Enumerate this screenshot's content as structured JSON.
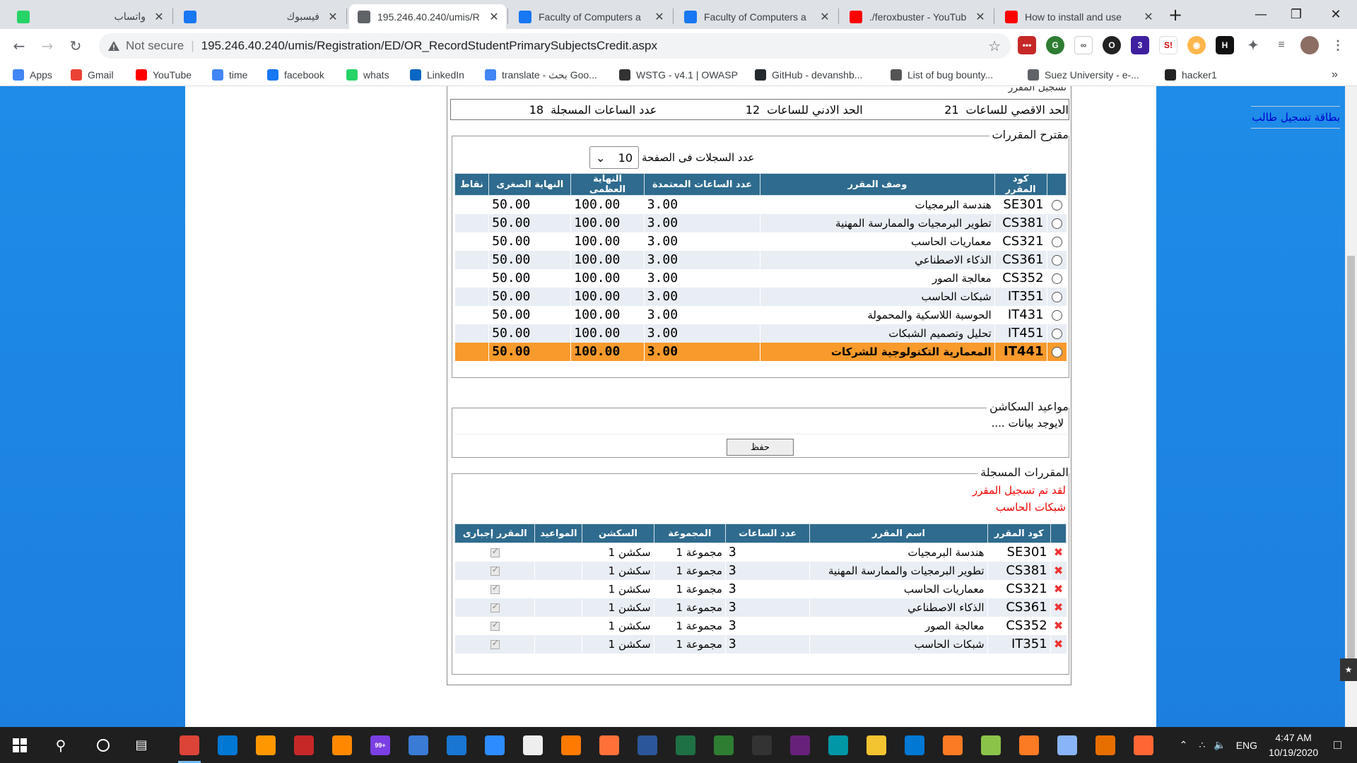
{
  "browser": {
    "tabs": [
      {
        "title": "واتساب",
        "rtl": true,
        "icon": "whatsapp-icon",
        "color": "#25d366"
      },
      {
        "title": "فيسبوك",
        "rtl": true,
        "icon": "facebook-icon",
        "color": "#1877f2"
      },
      {
        "title": "195.246.40.240/umis/R",
        "rtl": false,
        "icon": "globe-icon",
        "color": "#5f6368",
        "active": true
      },
      {
        "title": "Faculty of Computers a",
        "rtl": false,
        "icon": "facebook-icon",
        "color": "#1877f2"
      },
      {
        "title": "Faculty of Computers a",
        "rtl": false,
        "icon": "facebook-icon",
        "color": "#1877f2"
      },
      {
        "title": "./feroxbuster - YouTub",
        "rtl": false,
        "icon": "youtube-icon",
        "color": "#ff0000"
      },
      {
        "title": "How to install and use",
        "rtl": false,
        "icon": "youtube-icon",
        "color": "#ff0000"
      }
    ],
    "new_tab": "+",
    "address": {
      "security": "Not secure",
      "url": "195.246.40.240/umis/Registration/ED/OR_RecordStudentPrimarySubjectsCredit.aspx"
    },
    "bookmarks": [
      {
        "label": "Apps",
        "icon": "apps-icon",
        "color": "#4285f4"
      },
      {
        "label": "Gmail",
        "icon": "gmail-icon",
        "color": "#ea4335"
      },
      {
        "label": "YouTube",
        "icon": "youtube-icon",
        "color": "#ff0000"
      },
      {
        "label": "time",
        "icon": "google-icon",
        "color": "#4285f4"
      },
      {
        "label": "facebook",
        "icon": "facebook-icon",
        "color": "#1877f2"
      },
      {
        "label": "whats",
        "icon": "whatsapp-icon",
        "color": "#25d366"
      },
      {
        "label": "LinkedIn",
        "icon": "linkedin-icon",
        "color": "#0a66c2"
      },
      {
        "label": "translate - بحث Goo...",
        "icon": "google-icon",
        "color": "#4285f4"
      },
      {
        "label": "WSTG - v4.1 | OWASP",
        "icon": "owasp-icon",
        "color": "#333333"
      },
      {
        "label": "GitHub - devanshb...",
        "icon": "github-icon",
        "color": "#24292e"
      },
      {
        "label": "List of bug bounty...",
        "icon": "bug-icon",
        "color": "#555555"
      },
      {
        "label": "Suez University - e-...",
        "icon": "globe-icon",
        "color": "#5f6368"
      },
      {
        "label": "hacker1",
        "icon": "hackerone-icon",
        "color": "#222222"
      }
    ],
    "bookmarks_more": "»"
  },
  "page": {
    "side_link": "بطاقة تسجيل طالب",
    "top_cut": "تسجيل المقرر",
    "summary": [
      {
        "label": "الحد الاقصي للساعات",
        "value": "21"
      },
      {
        "label": "الحد الادني للساعات",
        "value": "12"
      },
      {
        "label": "عدد الساعات المسجلة",
        "value": "18"
      }
    ],
    "proposed": {
      "legend": "مقترح المقررات",
      "page_size_label": "عدد السجلات فى الصفحة",
      "page_size": "10",
      "headers": [
        "كود المقرر",
        "وصف المقرر",
        "عدد الساعات المعتمدة",
        "النهاية العظمى",
        "النهاية الصغرى",
        "نقاط"
      ],
      "rows": [
        {
          "code": "SE301",
          "desc": "هندسة البرمجيات",
          "hours": "3.00",
          "max": "100.00",
          "min": "50.00"
        },
        {
          "code": "CS381",
          "desc": "تطوير البرمجيات والممارسة المهنية",
          "hours": "3.00",
          "max": "100.00",
          "min": "50.00"
        },
        {
          "code": "CS321",
          "desc": "معماريات الحاسب",
          "hours": "3.00",
          "max": "100.00",
          "min": "50.00"
        },
        {
          "code": "CS361",
          "desc": "الذكاء الاصطناعي",
          "hours": "3.00",
          "max": "100.00",
          "min": "50.00"
        },
        {
          "code": "CS352",
          "desc": "معالجة الصور",
          "hours": "3.00",
          "max": "100.00",
          "min": "50.00"
        },
        {
          "code": "IT351",
          "desc": "شبكات الحاسب",
          "hours": "3.00",
          "max": "100.00",
          "min": "50.00"
        },
        {
          "code": "IT431",
          "desc": "الحوسبة اللاسكية والمحمولة",
          "hours": "3.00",
          "max": "100.00",
          "min": "50.00"
        },
        {
          "code": "IT451",
          "desc": "تحليل وتصميم الشبكات",
          "hours": "3.00",
          "max": "100.00",
          "min": "50.00"
        },
        {
          "code": "IT441",
          "desc": "المعمارية التكنولوجية للشركات",
          "hours": "3.00",
          "max": "100.00",
          "min": "50.00",
          "selected": true
        }
      ],
      "highlight_color": "#f89a2c"
    },
    "sections": {
      "legend": "مواعيد السكاشن",
      "empty_text": "لايوجد بيانات ....",
      "save_label": "حفظ"
    },
    "registered": {
      "legend": "المقررات المسجلة",
      "message": "لقد تم تسجيل المقرر",
      "message_course": "شبكات الحاسب",
      "headers": [
        "كود المقرر",
        "اسم المقرر",
        "عدد الساعات",
        "المجموعة",
        "السكشن",
        "المواعيد",
        "المقرر إجبارى"
      ],
      "rows": [
        {
          "code": "SE301",
          "name": "هندسة البرمجيات",
          "hours": "3",
          "group": "مجموعة 1",
          "section": "سكشن 1"
        },
        {
          "code": "CS381",
          "name": "تطوير البرمجيات والممارسة المهنية",
          "hours": "3",
          "group": "مجموعة 1",
          "section": "سكشن 1"
        },
        {
          "code": "CS321",
          "name": "معماريات الحاسب",
          "hours": "3",
          "group": "مجموعة 1",
          "section": "سكشن 1"
        },
        {
          "code": "CS361",
          "name": "الذكاء الاصطناعي",
          "hours": "3",
          "group": "مجموعة 1",
          "section": "سكشن 1"
        },
        {
          "code": "CS352",
          "name": "معالجة الصور",
          "hours": "3",
          "group": "مجموعة 1",
          "section": "سكشن 1"
        },
        {
          "code": "IT351",
          "name": "شبكات الحاسب",
          "hours": "3",
          "group": "مجموعة 1",
          "section": "سكشن 1"
        }
      ]
    }
  },
  "taskbar": {
    "apps": [
      {
        "icon": "chrome-icon",
        "color": "#db4437",
        "open": true
      },
      {
        "icon": "vscode-icon",
        "color": "#0078d4"
      },
      {
        "icon": "sublime-icon",
        "color": "#ff9800"
      },
      {
        "icon": "cherry-icon",
        "color": "#c62828"
      },
      {
        "icon": "vlc-icon",
        "color": "#ff8800"
      },
      {
        "icon": "badge-app-icon",
        "color": "#7b3fe4",
        "badge": "99+"
      },
      {
        "icon": "folder-app-icon",
        "color": "#3a7bd5"
      },
      {
        "icon": "cube-icon",
        "color": "#1976d2"
      },
      {
        "icon": "zoom-icon",
        "color": "#2d8cff"
      },
      {
        "icon": "document-icon",
        "color": "#eeeeee"
      },
      {
        "icon": "g-app-icon",
        "color": "#ff7a00"
      },
      {
        "icon": "firefox-icon",
        "color": "#ff7139"
      },
      {
        "icon": "word-icon",
        "color": "#2b579a"
      },
      {
        "icon": "sheets-icon",
        "color": "#1e7145"
      },
      {
        "icon": "globe-app-icon",
        "color": "#2e7d32"
      },
      {
        "icon": "terminal-icon",
        "color": "#333333"
      },
      {
        "icon": "visual-studio-icon",
        "color": "#68217a"
      },
      {
        "icon": "network-icon",
        "color": "#0097a7"
      },
      {
        "icon": "file-explorer-icon",
        "color": "#f4c430"
      },
      {
        "icon": "mail-icon",
        "color": "#0078d4"
      },
      {
        "icon": "xampp-icon",
        "color": "#fb7a24"
      },
      {
        "icon": "tools-icon",
        "color": "#8bc34a"
      },
      {
        "icon": "xampp-icon",
        "color": "#fb7a24"
      },
      {
        "icon": "drive-icon",
        "color": "#8ab4f8"
      },
      {
        "icon": "java-icon",
        "color": "#e76f00"
      },
      {
        "icon": "burp-icon",
        "color": "#ff6633"
      }
    ],
    "language": "ENG",
    "time": "4:47 AM",
    "date": "10/19/2020"
  }
}
